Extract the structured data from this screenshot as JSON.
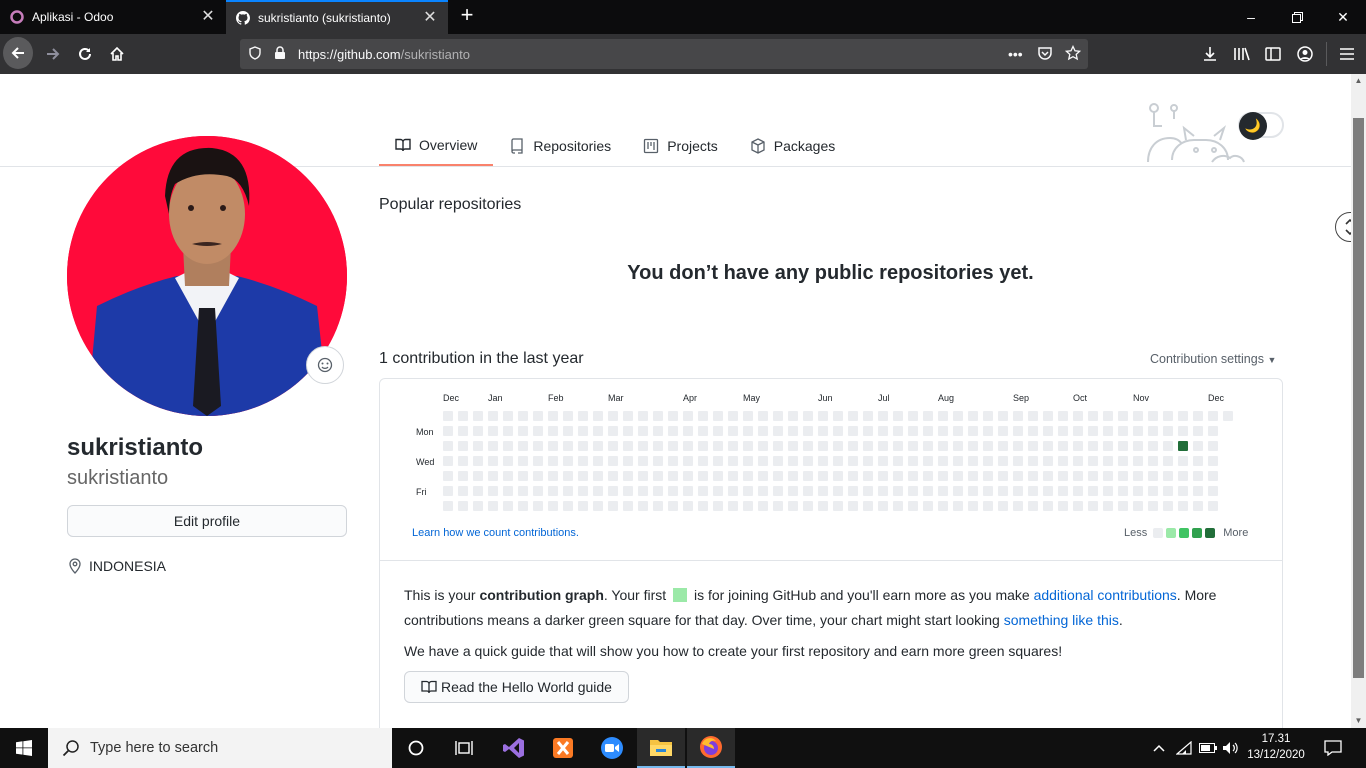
{
  "browser": {
    "tabs": [
      {
        "title": "Aplikasi - Odoo",
        "active": false
      },
      {
        "title": "sukristianto (sukristianto)",
        "active": true
      }
    ],
    "url_domain": "https://github.com",
    "url_path": "/sukristianto"
  },
  "profile": {
    "fullname": "sukristianto",
    "username": "sukristianto",
    "edit_label": "Edit profile",
    "location": "INDONESIA"
  },
  "nav": {
    "tabs": [
      "Overview",
      "Repositories",
      "Projects",
      "Packages"
    ]
  },
  "content": {
    "popular_title": "Popular repositories",
    "no_repos": "You don’t have any public repositories yet.",
    "contrib_title": "1 contribution in the last year",
    "contrib_settings": "Contribution settings",
    "learn_link": "Learn how we count contributions.",
    "legend_less": "Less",
    "legend_more": "More",
    "info": {
      "p1_a": "This is your ",
      "p1_b": "contribution graph",
      "p1_c": ". Your first ",
      "p1_d": " is for joining GitHub and you'll earn more as you make ",
      "p1_link1": "additional contributions",
      "p1_e": ". More contributions means a darker green square for that day. Over time, your chart might start looking ",
      "p1_link2": "something like this",
      "p1_f": ".",
      "p2": "We have a quick guide that will show you how to create your first repository and earn more green squares!",
      "guide_btn": "Read the Hello World guide"
    }
  },
  "chart_data": {
    "type": "heatmap",
    "months": [
      "Dec",
      "Jan",
      "Feb",
      "Mar",
      "Apr",
      "May",
      "Jun",
      "Jul",
      "Aug",
      "Sep",
      "Oct",
      "Nov",
      "Dec"
    ],
    "days": [
      "Mon",
      "Wed",
      "Fri"
    ],
    "total_contributions": 1,
    "contribution_cell": {
      "month": "Nov",
      "weekday": "Tue",
      "level": 4
    },
    "legend_colors": [
      "#ebedf0",
      "#9be9a8",
      "#40c463",
      "#30a14e",
      "#216e39"
    ]
  },
  "taskbar": {
    "search_placeholder": "Type here to search",
    "time": "17.31",
    "date": "13/12/2020"
  }
}
